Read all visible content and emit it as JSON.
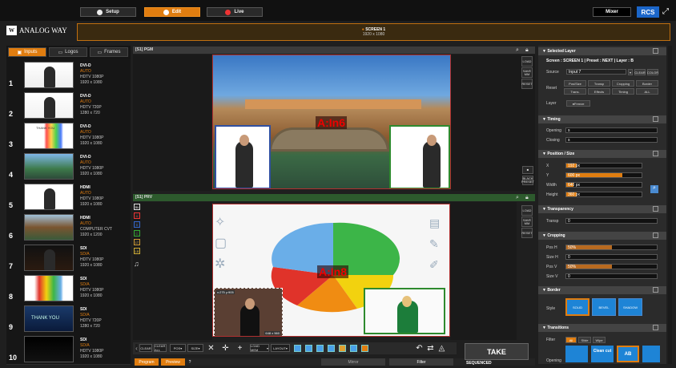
{
  "topbar": {
    "tabs": [
      {
        "label": "Setup",
        "active": false
      },
      {
        "label": "Edit",
        "active": true
      },
      {
        "label": "Live",
        "active": false
      }
    ],
    "mixer_label": "Mixer",
    "rcs_label": "RCS"
  },
  "logo": {
    "text": "ANALOG WAY"
  },
  "screen": {
    "title": "SCREEN 1",
    "resolution": "1920 x 1080"
  },
  "left_tabs": [
    {
      "label": "Inputs",
      "active": true
    },
    {
      "label": "Logos",
      "active": false
    },
    {
      "label": "Frames",
      "active": false
    }
  ],
  "inputs": [
    {
      "num": "1",
      "type": "DVI-D",
      "status": "AUTO",
      "format": "HDTV 1080P",
      "res": "1920 x 1080"
    },
    {
      "num": "2",
      "type": "DVI-D",
      "status": "AUTO",
      "format": "HDTV 720P",
      "res": "1280 x 720"
    },
    {
      "num": "3",
      "type": "DVI-D",
      "status": "AUTO",
      "format": "HDTV 1080P",
      "res": "1920 x 1080"
    },
    {
      "num": "4",
      "type": "DVI-D",
      "status": "AUTO",
      "format": "HDTV 1080P",
      "res": "1920 x 1080"
    },
    {
      "num": "5",
      "type": "HDMI",
      "status": "AUTO",
      "format": "HDTV 1080P",
      "res": "1920 x 1080"
    },
    {
      "num": "6",
      "type": "HDMI",
      "status": "AUTO",
      "format": "COMPUTER CVT",
      "res": "1920 x 1200"
    },
    {
      "num": "7",
      "type": "SDI",
      "status": "SD/A",
      "format": "HDTV 1080P",
      "res": "1920 x 1080"
    },
    {
      "num": "8",
      "type": "SDI",
      "status": "SD/A",
      "format": "HDTV 1080P",
      "res": "1920 x 1080"
    },
    {
      "num": "9",
      "type": "SDI",
      "status": "SD/A",
      "format": "HDTV 720P",
      "res": "1280 x 720"
    },
    {
      "num": "10",
      "type": "SDI",
      "status": "SD/A",
      "format": "HDTV 1080P",
      "res": "1920 x 1080"
    }
  ],
  "thumb_text": {
    "t3": "THANK YOU",
    "t9": "THANK YOU"
  },
  "pgm": {
    "label": "[S1] PGM",
    "layer_label": "A:In6"
  },
  "prw": {
    "label": "[S1] PRV",
    "layer_label": "A:In8",
    "sel_pos": "x:275  y:905",
    "sel_size": "648 x 560"
  },
  "left_buttons": [
    "Bk",
    "A",
    "B",
    "C",
    "LT",
    "LB"
  ],
  "right_buttons": [
    "LOAD",
    "SAVE MM",
    "RESET"
  ],
  "right_buttons_prw": [
    "LOAD",
    "SAVE MM",
    "RESET"
  ],
  "black_preset": "BLACK PRESET",
  "toolbar": {
    "clear": "CLEAR",
    "clear_all": "CLEAR ALL",
    "pos": "POS",
    "size": "SIZE",
    "load_memory": "LOAD MEM",
    "layout": "LAYOUT"
  },
  "bottom": {
    "program": "Program",
    "preview": "Preview",
    "help": "?",
    "mirror": "Mirror",
    "filter": "Filter",
    "take": "TAKE",
    "sequenced": "SEQUENCED"
  },
  "right": {
    "selected_layer": {
      "title": "Selected Layer",
      "info": "Screen : SCREEN 1  |  Preset : NEXT  |  Layer : B",
      "source_label": "Source",
      "source_value": "Input 7",
      "clear": "CLEAR",
      "color": "COLOR",
      "reset_label": "Reset",
      "reset_chips": [
        "Pos/Size",
        "Transp",
        "Cropping",
        "Border",
        "Trans.",
        "Effects",
        "Timing",
        "ALL"
      ],
      "layer_label": "Layer",
      "freeze": "Freeze"
    },
    "timing": {
      "title": "Timing",
      "opening_label": "Opening",
      "opening_value": "s",
      "closing_label": "Closing",
      "closing_value": "s"
    },
    "possize": {
      "title": "Position / Size",
      "x_label": "X",
      "x_value": "192 px",
      "y_label": "Y",
      "y_value": "600 px",
      "w_label": "Width",
      "w_value": "640 px",
      "h_label": "Height",
      "h_value": "360 px"
    },
    "transparency": {
      "title": "Transparency",
      "label": "Transp",
      "value": "0"
    },
    "cropping": {
      "title": "Cropping",
      "pos_h": "Pos H",
      "size_h": "Size H",
      "pos_v": "Pos V",
      "size_v": "Size V",
      "val_pos_h": "50%",
      "val_size_h": "0",
      "val_pos_v": "50%",
      "val_size_v": "0"
    },
    "border": {
      "title": "Border",
      "style_label": "Style",
      "styles": [
        "SOLID",
        "BEVEL",
        "SHADOW"
      ]
    },
    "transitions": {
      "title": "Transitions",
      "filter_label": "Filter",
      "filters": [
        "All",
        "Slide",
        "Wipe"
      ],
      "opening_label": "Opening",
      "cut_label": "Clean cut",
      "ab_label": "AB"
    }
  },
  "chart_labels": {
    "a": "A:In6",
    "b": "A:In8"
  }
}
